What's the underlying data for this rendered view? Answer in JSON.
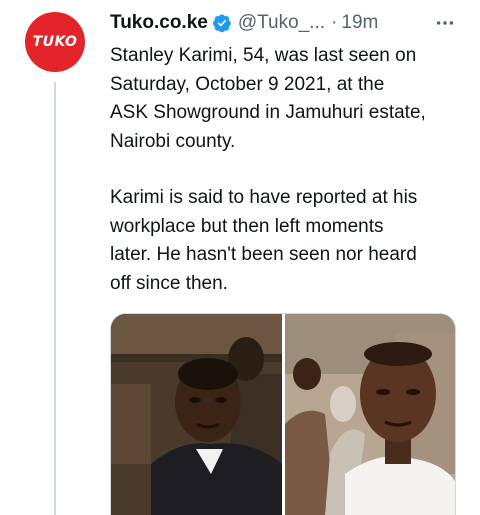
{
  "author": {
    "name": "Tuko.co.ke",
    "handle": "@Tuko_...",
    "separator": "·",
    "time": "19m",
    "avatar_text": "TUKO",
    "avatar_color": "#e3242b",
    "verified_color": "#1d9bf0"
  },
  "tweet": {
    "paragraph_1": "Stanley Karimi, 54, was last seen on\nSaturday, October 9 2021, at the\nASK Showground in Jamuhuri estate,\nNairobi county.",
    "paragraph_2": "Karimi is said to have reported at his\nworkplace but then left moments\nlater. He hasn't been seen nor heard\noff since then."
  },
  "media": {
    "photos": [
      {
        "description_icon": "man-in-suit-photo"
      },
      {
        "description_icon": "man-in-white-shirt-photo"
      }
    ]
  },
  "icons": {
    "verified": "verified-badge-icon",
    "more": "more-options-icon"
  }
}
